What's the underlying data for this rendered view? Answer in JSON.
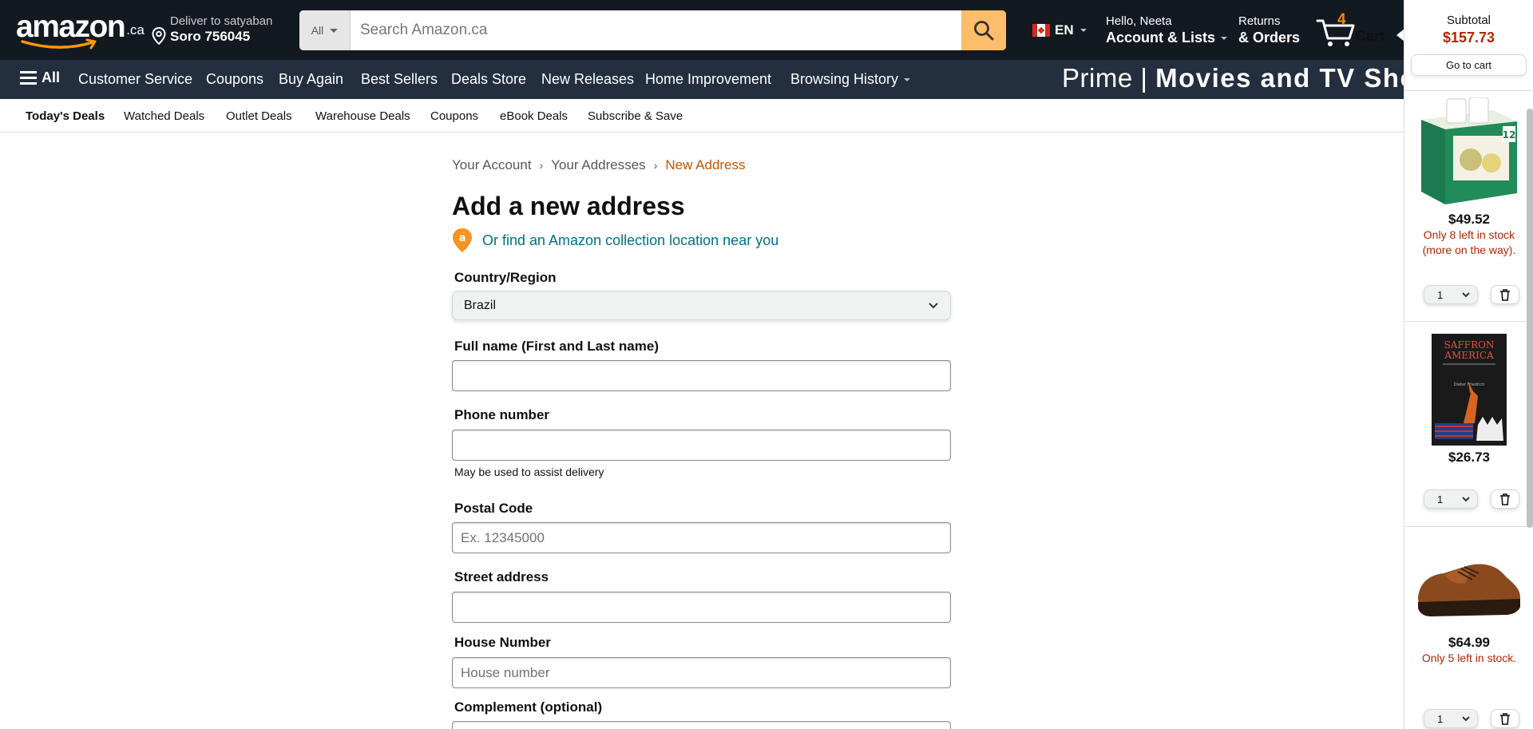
{
  "header": {
    "logo_text": "amazon",
    "logo_suffix": ".ca",
    "deliver_line1": "Deliver to satyaban",
    "deliver_line2": "Soro 756045",
    "search_category": "All",
    "search_placeholder": "Search Amazon.ca",
    "language": "EN",
    "account_line1": "Hello, Neeta",
    "account_line2": "Account & Lists",
    "returns_line1": "Returns",
    "returns_line2": "& Orders",
    "cart_count": "4",
    "cart_label": "Cart"
  },
  "nav": {
    "all_label": "All",
    "items": [
      "Customer Service",
      "Coupons",
      "Buy Again",
      "Best Sellers",
      "Deals Store",
      "New Releases",
      "Home Improvement",
      "Browsing History"
    ],
    "prime_banner_left": "Prime",
    "prime_banner_sep": "|",
    "prime_banner_right": "Movies and TV Shows"
  },
  "subnav": {
    "items": [
      "Today's Deals",
      "Watched Deals",
      "Outlet Deals",
      "Warehouse Deals",
      "Coupons",
      "eBook Deals",
      "Subscribe & Save"
    ]
  },
  "breadcrumb": {
    "items": [
      "Your Account",
      "Your Addresses",
      "New Address"
    ],
    "separator": "›"
  },
  "form": {
    "title": "Add a new address",
    "collection_link": "Or find an Amazon collection location near you",
    "country_label": "Country/Region",
    "country_value": "Brazil",
    "fullname_label": "Full name (First and Last name)",
    "fullname_value": "",
    "phone_label": "Phone number",
    "phone_value": "",
    "phone_hint": "May be used to assist delivery",
    "postal_label": "Postal Code",
    "postal_placeholder": "Ex. 12345000",
    "street_label": "Street address",
    "street_value": "",
    "house_label": "House Number",
    "house_placeholder": "House number",
    "complement_label": "Complement (optional)"
  },
  "cart_panel": {
    "subtotal_label": "Subtotal",
    "subtotal_value": "$157.73",
    "go_to_cart": "Go to cart",
    "products": [
      {
        "name": "Baby Gourmet pouches",
        "price": "$49.52",
        "stock_line1": "Only 8 left in stock",
        "stock_line2": "(more on the way).",
        "qty": "1"
      },
      {
        "name": "Saffron America book",
        "price": "$26.73",
        "stock_line1": "",
        "stock_line2": "",
        "qty": "1"
      },
      {
        "name": "Brown leather shoe",
        "price": "$64.99",
        "stock_line1": "Only 5 left in stock.",
        "stock_line2": "",
        "qty": "1"
      }
    ],
    "book_title_line1": "SAFFRON",
    "book_title_line2": "AMERICA",
    "book_author": "Dieter Friedrich"
  },
  "colors": {
    "nav_dark": "#131921",
    "nav_secondary": "#232f3e",
    "search_button": "#febd69",
    "link_teal": "#007185",
    "breadcrumb_active": "#c45500",
    "price_red": "#b12704",
    "cart_count_orange": "#f08804"
  }
}
